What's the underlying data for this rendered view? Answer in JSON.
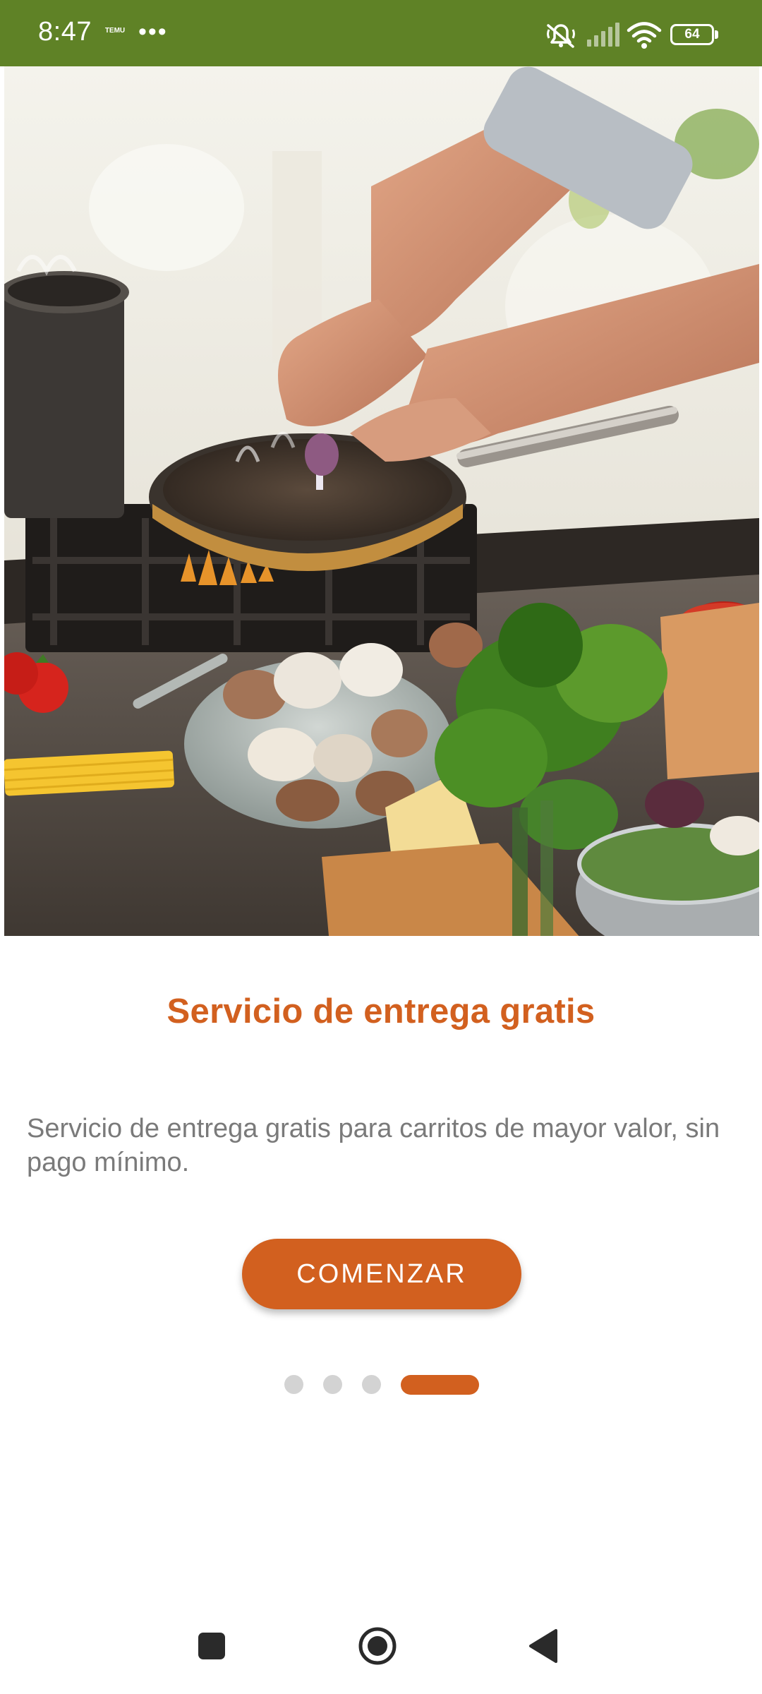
{
  "status_bar": {
    "time": "8:47",
    "app_icon_text": "TEMU",
    "more": "•••",
    "icons": [
      "muted-bell-icon",
      "cellular-signal-icon",
      "wifi-icon"
    ],
    "battery": "64"
  },
  "hero": {
    "image": "chef-cooking-photo"
  },
  "onboarding": {
    "title": "Servicio de entrega gratis",
    "description": "Servicio de entrega gratis para carritos de mayor valor, sin pago mínimo.",
    "cta_label": "COMENZAR"
  },
  "pager": {
    "total": 4,
    "active_index": 3
  },
  "nav_bar": {
    "icons": [
      "recents-square-icon",
      "home-circle-icon",
      "back-triangle-icon"
    ]
  },
  "colors": {
    "status_bar": "#5f8226",
    "accent": "#d2601f",
    "text_muted": "#7a7a7a",
    "dot_inactive": "#d3d3d3"
  }
}
